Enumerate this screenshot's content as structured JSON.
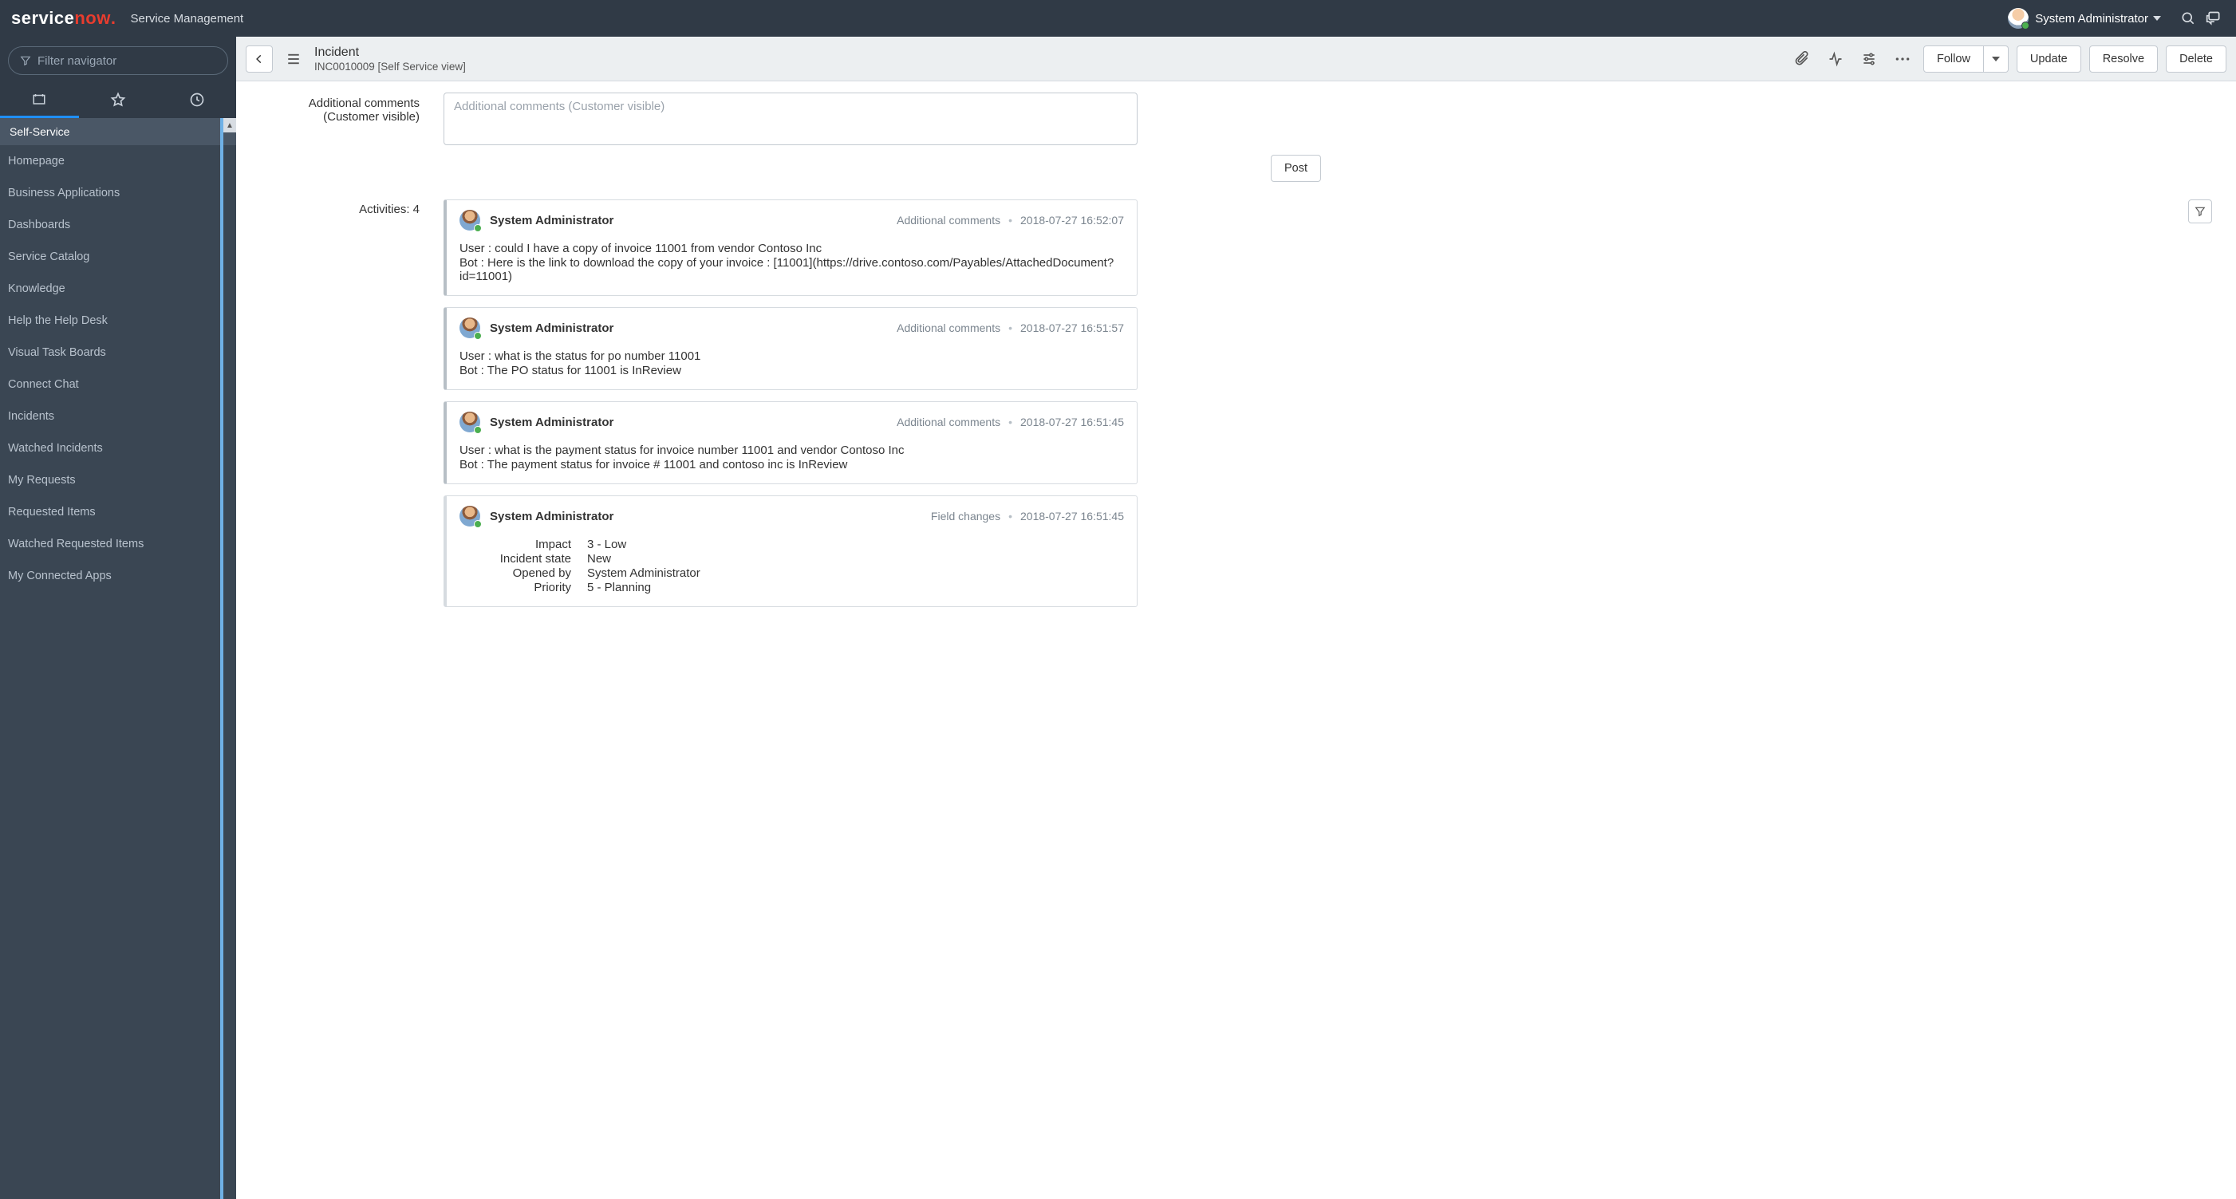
{
  "banner": {
    "product_1": "service",
    "product_2": "now",
    "product_sfx": ".",
    "title": "Service Management",
    "user_name": "System Administrator"
  },
  "sidebar": {
    "filter_placeholder": "Filter navigator",
    "section_title": "Self-Service",
    "items": [
      "Homepage",
      "Business Applications",
      "Dashboards",
      "Service Catalog",
      "Knowledge",
      "Help the Help Desk",
      "Visual Task Boards",
      "Connect Chat",
      "Incidents",
      "Watched Incidents",
      "My Requests",
      "Requested Items",
      "Watched Requested Items",
      "My Connected Apps"
    ]
  },
  "form": {
    "title": "Incident",
    "subtitle": "INC0010009 [Self Service view]",
    "buttons": {
      "follow": "Follow",
      "update": "Update",
      "resolve": "Resolve",
      "delete": "Delete",
      "post": "Post"
    },
    "labels": {
      "comments_1": "Additional comments",
      "comments_2": "(Customer visible)",
      "comments_placeholder": "Additional comments (Customer visible)",
      "activities": "Activities: 4"
    }
  },
  "activity_types": {
    "comments": "Additional comments",
    "field_changes": "Field changes"
  },
  "activities": [
    {
      "author": "System Administrator",
      "type": "comments",
      "ts": "2018-07-27 16:52:07",
      "lines": [
        "User : could I have a copy of invoice 11001 from vendor Contoso Inc",
        "Bot : Here is the link to download the copy of your invoice : [11001](https://drive.contoso.com/Payables/AttachedDocument?id=11001)"
      ]
    },
    {
      "author": "System Administrator",
      "type": "comments",
      "ts": "2018-07-27 16:51:57",
      "lines": [
        "User : what is the status for po number 11001",
        "Bot : The PO status for 11001 is InReview"
      ]
    },
    {
      "author": "System Administrator",
      "type": "comments",
      "ts": "2018-07-27 16:51:45",
      "lines": [
        "User : what is the payment status for invoice number 11001 and vendor Contoso Inc",
        "Bot : The payment status for invoice # 11001 and contoso inc is InReview"
      ]
    },
    {
      "author": "System Administrator",
      "type": "field_changes",
      "ts": "2018-07-27 16:51:45",
      "fields": [
        {
          "k": "Impact",
          "v": "3 - Low"
        },
        {
          "k": "Incident state",
          "v": "New"
        },
        {
          "k": "Opened by",
          "v": "System Administrator"
        },
        {
          "k": "Priority",
          "v": "5 - Planning"
        }
      ]
    }
  ]
}
